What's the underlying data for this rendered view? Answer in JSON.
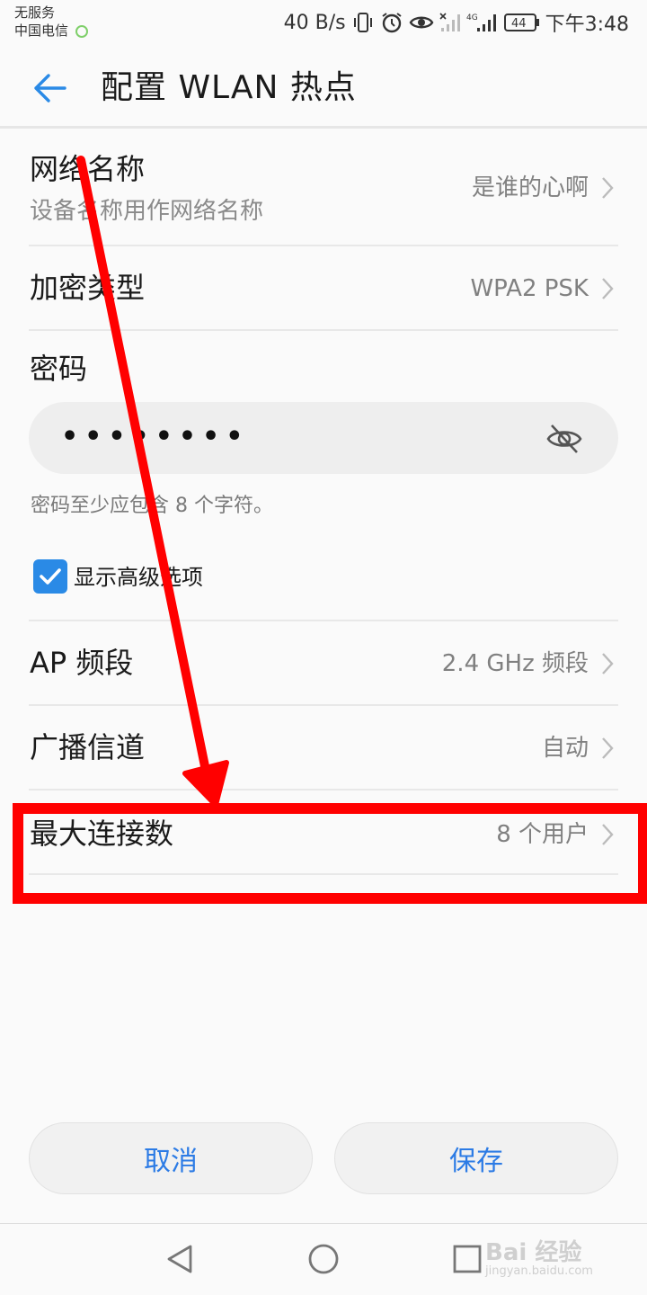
{
  "status_bar": {
    "carrier_line1": "无服务",
    "carrier_line2": "中国电信",
    "net_speed": "40 B/s",
    "network_type": "4G",
    "battery": "44",
    "time": "下午3:48"
  },
  "header": {
    "title": "配置 WLAN 热点"
  },
  "settings": {
    "network_name": {
      "label": "网络名称",
      "sublabel": "设备名称用作网络名称",
      "value": "是谁的心啊"
    },
    "encryption": {
      "label": "加密类型",
      "value": "WPA2 PSK"
    },
    "password": {
      "label": "密码",
      "masked_value": "••••••••",
      "hint": "密码至少应包含 8 个字符。"
    },
    "advanced": {
      "label": "显示高级选项",
      "checked": true
    },
    "ap_band": {
      "label": "AP 频段",
      "value": "2.4 GHz 频段"
    },
    "channel": {
      "label": "广播信道",
      "value": "自动"
    },
    "max_connections": {
      "label": "最大连接数",
      "value": "8 个用户"
    }
  },
  "actions": {
    "cancel_label": "取消",
    "save_label": "保存"
  },
  "watermark": {
    "brand": "Bai 经验",
    "url": "jingyan.baidu.com"
  },
  "colors": {
    "accent": "#2c7be5",
    "annotation_red": "#ff0000",
    "checkbox": "#2a8ae6"
  }
}
